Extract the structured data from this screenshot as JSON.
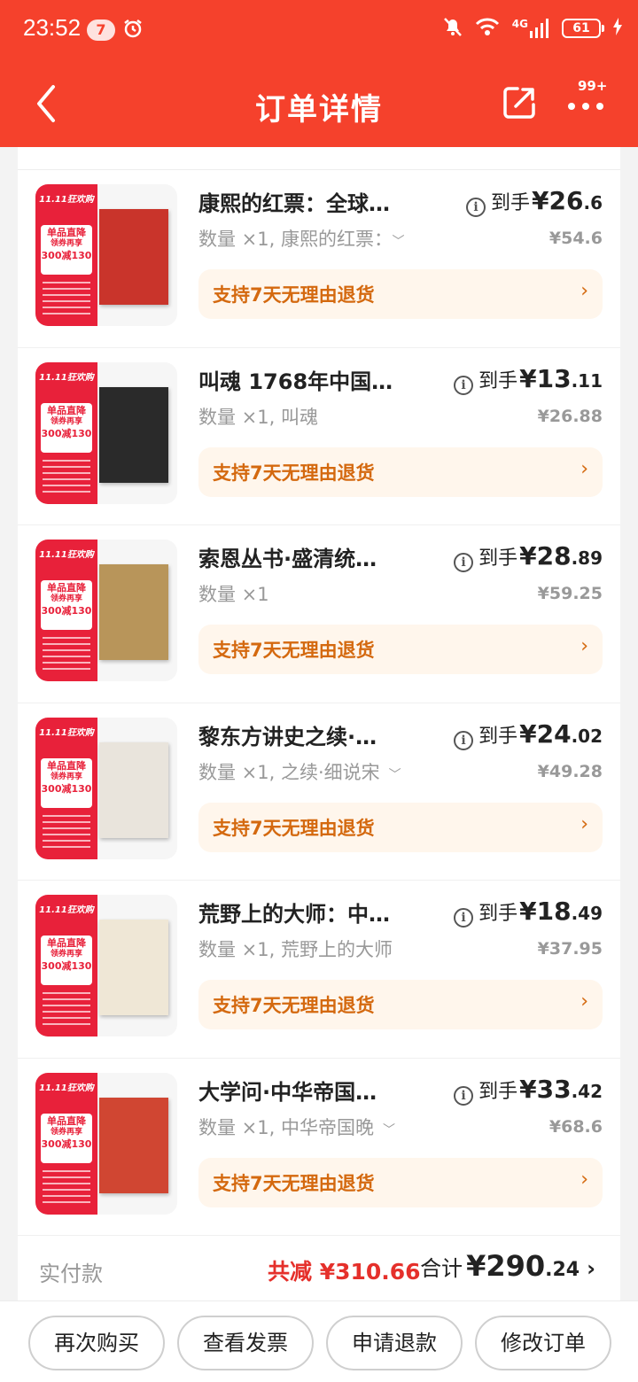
{
  "status_bar": {
    "time": "23:52",
    "notification_count": "7",
    "network": "4G",
    "battery": "61"
  },
  "header": {
    "title": "订单详情",
    "more_badge": "99+"
  },
  "colors": {
    "brand_red": "#f5412c",
    "return_text": "#d4690f",
    "reduce_red": "#e5302b"
  },
  "products": [
    {
      "name": "康熙的红票：全球…",
      "final_label": "到手",
      "final_int": "¥26",
      "final_dec": ".6",
      "meta": "数量 ×1, 康熙的红票：",
      "has_dropdown": true,
      "orig_price": "¥54.6",
      "return_text": "支持7天无理由退货",
      "promo_banner": "11.11狂欢购",
      "promo_card_1": "单品直降",
      "promo_card_2": "领券再享",
      "promo_card_3": "300减130"
    },
    {
      "name": "叫魂 1768年中国…",
      "final_label": "到手",
      "final_int": "¥13",
      "final_dec": ".11",
      "meta": "数量 ×1, 叫魂",
      "has_dropdown": false,
      "orig_price": "¥26.88",
      "return_text": "支持7天无理由退货",
      "promo_banner": "11.11狂欢购",
      "promo_card_1": "单品直降",
      "promo_card_2": "领券再享",
      "promo_card_3": "300减130"
    },
    {
      "name": "索恩丛书·盛清统…",
      "final_label": "到手",
      "final_int": "¥28",
      "final_dec": ".89",
      "meta": "数量 ×1",
      "has_dropdown": false,
      "orig_price": "¥59.25",
      "return_text": "支持7天无理由退货",
      "promo_banner": "11.11狂欢购",
      "promo_card_1": "单品直降",
      "promo_card_2": "领券再享",
      "promo_card_3": "300减130"
    },
    {
      "name": "黎东方讲史之续·…",
      "final_label": "到手",
      "final_int": "¥24",
      "final_dec": ".02",
      "meta": "数量 ×1, 之续·细说宋",
      "has_dropdown": true,
      "orig_price": "¥49.28",
      "return_text": "支持7天无理由退货",
      "promo_banner": "11.11狂欢购",
      "promo_card_1": "单品直降",
      "promo_card_2": "领券再享",
      "promo_card_3": "300减130"
    },
    {
      "name": "荒野上的大师：中…",
      "final_label": "到手",
      "final_int": "¥18",
      "final_dec": ".49",
      "meta": "数量 ×1, 荒野上的大师",
      "has_dropdown": false,
      "orig_price": "¥37.95",
      "return_text": "支持7天无理由退货",
      "promo_banner": "11.11狂欢购",
      "promo_card_1": "单品直降",
      "promo_card_2": "领券再享",
      "promo_card_3": "300减130"
    },
    {
      "name": "大学问·中华帝国…",
      "final_label": "到手",
      "final_int": "¥33",
      "final_dec": ".42",
      "meta": "数量 ×1, 中华帝国晚",
      "has_dropdown": true,
      "orig_price": "¥68.6",
      "return_text": "支持7天无理由退货",
      "promo_banner": "11.11狂欢购",
      "promo_card_1": "单品直降",
      "promo_card_2": "领券再享",
      "promo_card_3": "300减130"
    }
  ],
  "summary": {
    "label": "实付款",
    "reduce": "共减 ¥310.66",
    "total_label": "合计",
    "total_int": "¥290",
    "total_dec": ".24"
  },
  "actions": [
    {
      "label": "再次购买"
    },
    {
      "label": "查看发票"
    },
    {
      "label": "申请退款"
    },
    {
      "label": "修改订单"
    }
  ],
  "book_colors": [
    "#c9342b",
    "#2a2a2a",
    "#b8955a",
    "#e9e4dc",
    "#efe7d6",
    "#d04632"
  ]
}
